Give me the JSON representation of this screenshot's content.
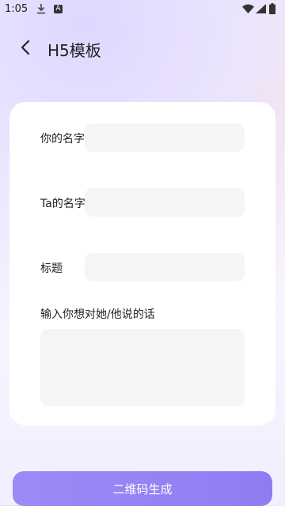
{
  "status_bar": {
    "time": "1:05",
    "download_icon": "download-icon",
    "notification_icon": "a-badge-icon",
    "wifi_icon": "wifi-icon",
    "signal_icon": "signal-icon",
    "battery_icon": "battery-icon"
  },
  "header": {
    "title": "H5模板",
    "back_icon": "chevron-left-icon"
  },
  "form": {
    "your_name_label": "你的名字",
    "your_name_value": "",
    "ta_name_label": "Ta的名字",
    "ta_name_value": "",
    "title_label": "标题",
    "title_value": "",
    "message_label": "输入你想对她/他说的话",
    "message_value": ""
  },
  "footer": {
    "generate_label": "二维码生成"
  },
  "colors": {
    "accent": "#9a8bf6",
    "input_bg": "#f5f5f7",
    "card_bg": "#ffffff"
  }
}
